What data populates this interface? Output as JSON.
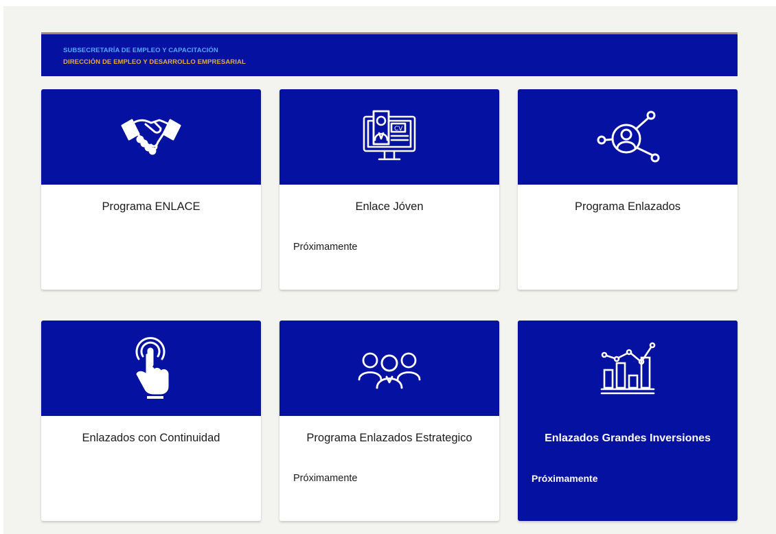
{
  "header": {
    "line1": "SUBSECRETARÍA DE EMPLEO Y CAPACITACIÓN",
    "line2": "DIRECCIÓN DE EMPLEO Y DESARROLLO EMPRESARIAL"
  },
  "colors": {
    "primary": "#0511a0",
    "line1_accent": "#54a7ff",
    "line2_accent": "#e0ad44",
    "page_background": "#f3f3ef"
  },
  "cards": [
    {
      "title": "Programa ENLACE",
      "subtitle": "",
      "icon": "handshake-icon"
    },
    {
      "title": "Enlace Jóven",
      "subtitle": "Próximamente",
      "icon": "cv-monitor-icon"
    },
    {
      "title": "Programa Enlazados",
      "subtitle": "",
      "icon": "network-user-icon"
    },
    {
      "title": "Enlazados con Continuidad",
      "subtitle": "",
      "icon": "touch-hand-icon"
    },
    {
      "title": "Programa Enlazados Estrategico",
      "subtitle": "Próximamente",
      "icon": "group-people-icon"
    },
    {
      "title": "Enlazados Grandes Inversiones",
      "subtitle": "Próximamente",
      "icon": "growth-chart-icon"
    }
  ]
}
